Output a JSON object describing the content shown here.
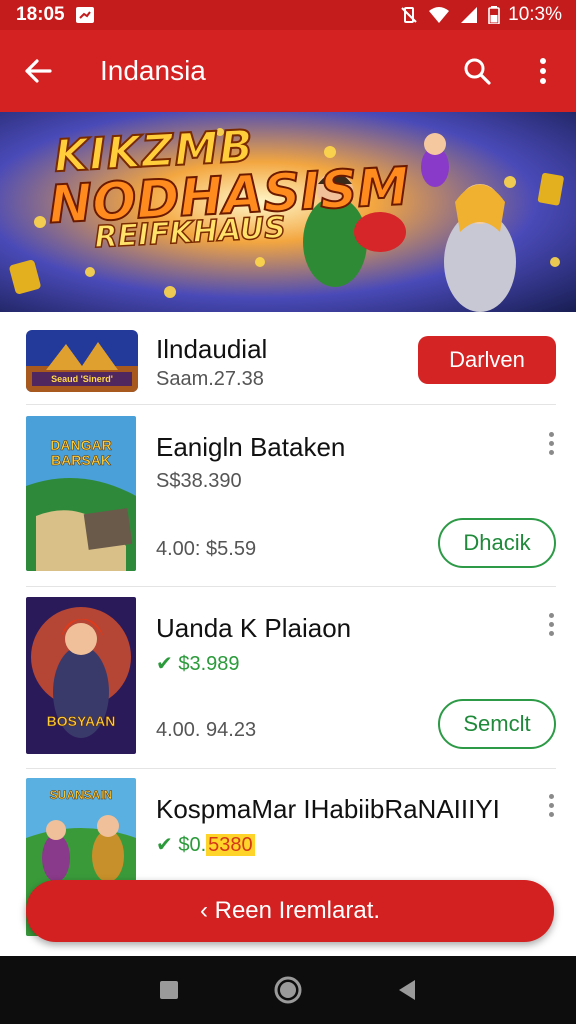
{
  "status_bar": {
    "time": "18:05",
    "battery_time": "10:3%"
  },
  "app_bar": {
    "title": "Indansia",
    "icons": [
      "back-arrow-icon",
      "search-icon",
      "more-vert-icon"
    ]
  },
  "banner": {
    "line1": "KIKZMB",
    "line2": "NODHASISM",
    "line3": "REIFKHAUS"
  },
  "games": [
    {
      "title": "Ilndaudial",
      "subtitle": "Saam.27.38",
      "button": "Darlven",
      "thumb_caption": "Seaud 'Sinerd'"
    },
    {
      "title": "Eanigln Bataken",
      "subtitle": "S$38.390",
      "rating": "4.00: $5.59",
      "button": "Dhacik",
      "thumb_caption": "DANGAR BARSAK"
    },
    {
      "title": "Uanda K Plaiaon",
      "price": "$3.989",
      "rating": "4.00. 94.23",
      "button": "Semclt",
      "thumb_caption": "BOSYAAN"
    },
    {
      "title": "KospmaMar IHabiibRaNAIIIYI",
      "price_prefix": "$0.",
      "price_highlight": "5380",
      "thumb_caption": "SUANSAIN"
    }
  ],
  "fab": {
    "label": "‹ Reen Iremlarat."
  },
  "nav": [
    "recents-square-icon",
    "home-circle-icon",
    "back-triangle-icon"
  ],
  "colors": {
    "primary": "#d42121",
    "status_bar": "#c41c1c",
    "accent_green": "#2c9a46"
  }
}
